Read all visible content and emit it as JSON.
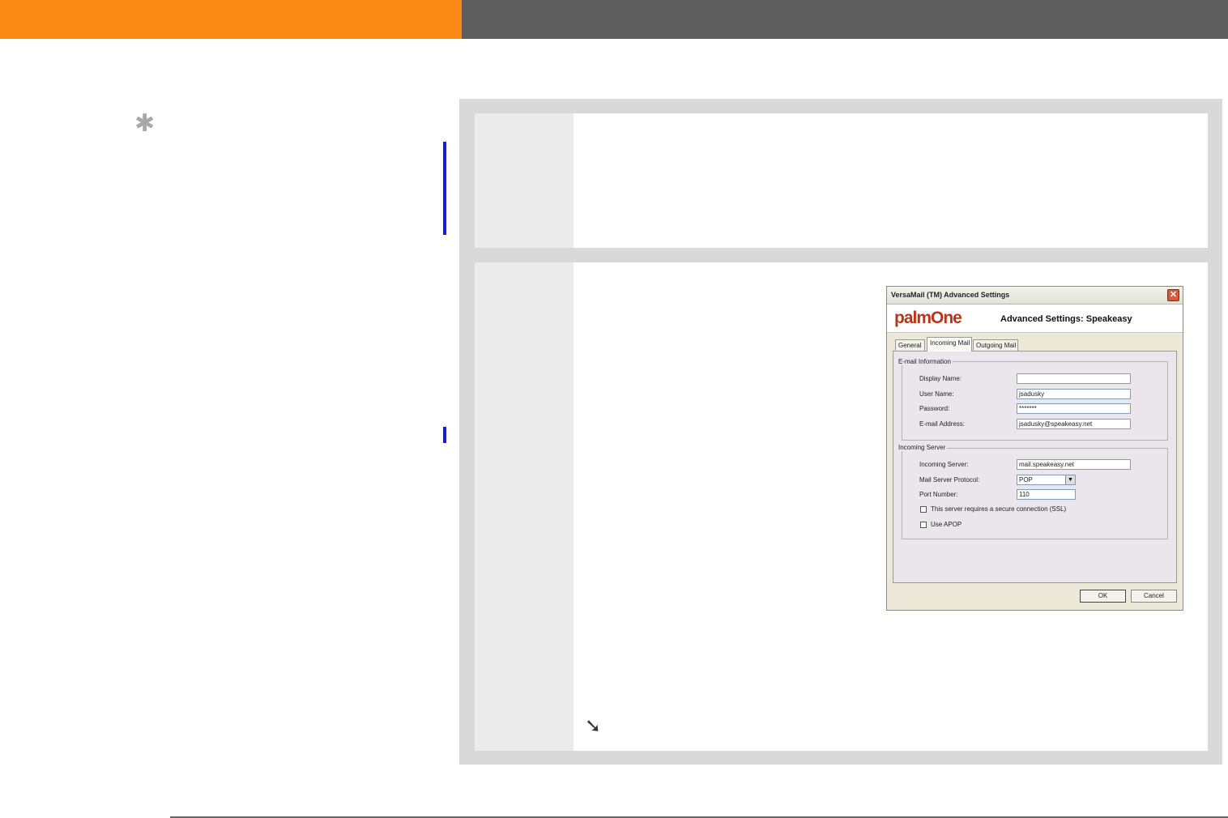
{
  "header": {
    "orange_color": "#fa8a15",
    "gray_color": "#5e5e5e"
  },
  "tip": {
    "icon": "asterisk-icon"
  },
  "steps": {
    "continue_icon": "arrow-down-right-icon",
    "continue_glyph": "➘"
  },
  "dialog": {
    "title": "VersaMail (TM) Advanced Settings",
    "close_glyph": "✕",
    "logo": "palmOne",
    "heading": "Advanced Settings: Speakeasy",
    "tabs": [
      "General",
      "Incoming Mail",
      "Outgoing Mail"
    ],
    "email_group": {
      "legend": "E-mail Information",
      "display_name_label": "Display Name:",
      "display_name_value": "",
      "user_name_label": "User Name:",
      "user_name_value": "jsadusky",
      "password_label": "Password:",
      "password_value": "*******",
      "email_label": "E-mail Address:",
      "email_value": "jsadusky@speakeasy.net"
    },
    "server_group": {
      "legend": "Incoming Server",
      "server_label": "Incoming Server:",
      "server_value": "mail.speakeasy.net",
      "protocol_label": "Mail Server Protocol:",
      "protocol_value": "POP",
      "port_label": "Port Number:",
      "port_value": "110",
      "ssl_label": "This server requires a secure connection (SSL)",
      "apop_label": "Use APOP"
    },
    "ok_label": "OK",
    "cancel_label": "Cancel"
  }
}
